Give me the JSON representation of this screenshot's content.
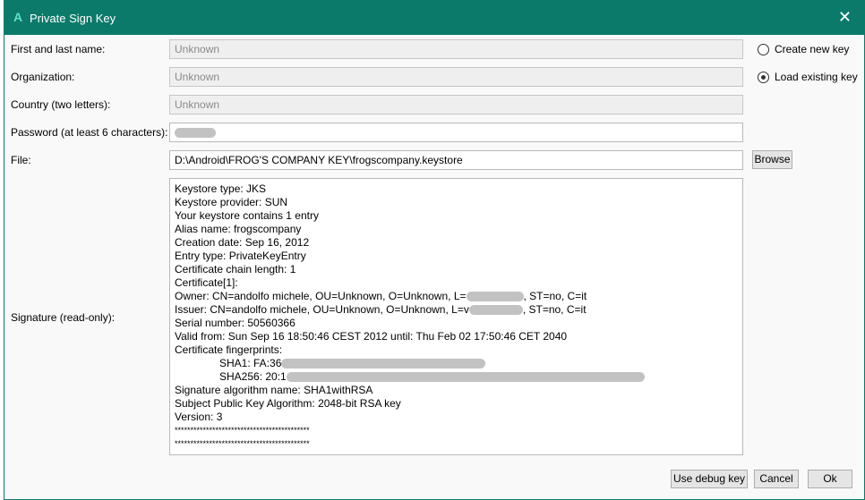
{
  "window": {
    "title": "Private Sign Key",
    "close_icon": "close-icon"
  },
  "form": {
    "name_label": "First and last name:",
    "name_value": "Unknown",
    "org_label": "Organization:",
    "org_value": "Unknown",
    "country_label": "Country (two letters):",
    "country_value": "Unknown",
    "password_label": "Password (at least 6 characters):",
    "file_label": "File:",
    "file_value": "D:\\Android\\FROG'S COMPANY KEY\\frogscompany.keystore",
    "browse": "Browse",
    "signature_label": "Signature (read-only):"
  },
  "options": {
    "create": "Create new key",
    "load": "Load existing key",
    "selected": "load"
  },
  "signature": {
    "lines": [
      "Keystore type: JKS",
      "Keystore provider: SUN",
      "Your keystore contains 1 entry",
      "Alias name: frogscompany",
      "Creation date: Sep 16, 2012",
      "Entry type: PrivateKeyEntry",
      "Certificate chain length: 1",
      "Certificate[1]:"
    ],
    "owner_a": "Owner: CN=andolfo michele, OU=Unknown, O=Unknown, L=",
    "owner_b": ", ST=no, C=it",
    "issuer_a": "Issuer: CN=andolfo michele, OU=Unknown, O=Unknown, L=v",
    "issuer_b": ", ST=no, C=it",
    "serial": "Serial number: 50560366",
    "valid": "Valid from: Sun Sep 16 18:50:46 CEST 2012 until: Thu Feb 02 17:50:46 CET 2040",
    "fp": "Certificate fingerprints:",
    "sha1": "SHA1: FA:36",
    "sha256": "SHA256: 20:1",
    "alg": "Signature algorithm name: SHA1withRSA",
    "pk": "Subject Public Key Algorithm: 2048-bit RSA key",
    "ver": "Version: 3",
    "stars": "*******************************************"
  },
  "buttons": {
    "debug": "Use debug key",
    "cancel": "Cancel",
    "ok": "Ok"
  },
  "colors": {
    "titlebar": "#0b7a6a"
  }
}
